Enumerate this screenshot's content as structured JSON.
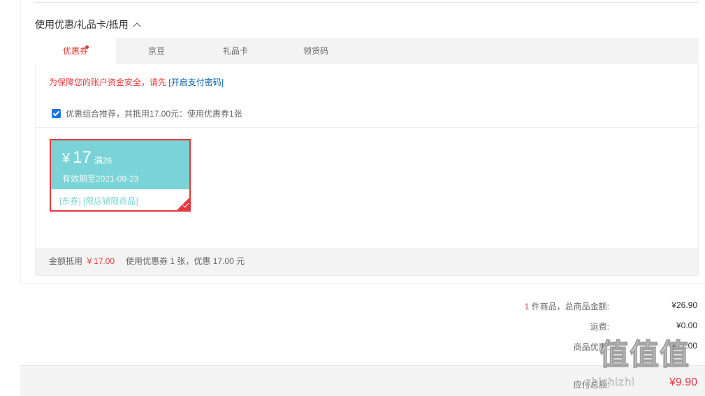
{
  "section": {
    "title": "使用优惠/礼品卡/抵用"
  },
  "tabs": [
    {
      "label": "优惠券",
      "active": true
    },
    {
      "label": "京豆"
    },
    {
      "label": "礼品卡"
    },
    {
      "label": "领货码"
    }
  ],
  "security": {
    "text": "为保障您的账户资金安全，请先",
    "link": "[开启支付密码]"
  },
  "combo": {
    "checked": true,
    "text": "优惠组合推荐，共抵用17.00元：使用优惠券1张"
  },
  "coupon": {
    "currency": "¥",
    "amount": "17",
    "condition": "满26",
    "expiry": "有效期至2021-09-23",
    "tags": "[东券]  [限店铺限商品]",
    "selected": true
  },
  "deduct": {
    "label": "金额抵用",
    "amount": "￥17.00",
    "detail": "使用优惠券 1 张，优惠 17.00 元"
  },
  "summary": {
    "count": "1",
    "goods_label": " 件商品，总商品金额:",
    "goods_value": "¥26.90",
    "shipping_label": "运费:",
    "shipping_value": "¥0.00",
    "discount_label": "商品优惠:",
    "discount_value": "-¥17.00",
    "payable_label": "应付总额:",
    "payable_value": "¥9.90"
  },
  "watermark": {
    "main": "值值值",
    "sub": "zhizhizhi"
  },
  "colors": {
    "accent": "#e4393c",
    "coupon": "#7ad3d6",
    "link": "#005aa0"
  }
}
